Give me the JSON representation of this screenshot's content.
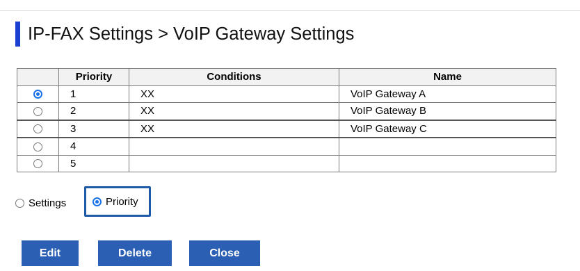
{
  "page": {
    "title": "IP-FAX Settings > VoIP Gateway Settings",
    "accent_color": "#1a3fd1"
  },
  "table": {
    "columns": [
      "",
      "Priority",
      "Conditions",
      "Name"
    ],
    "rows": [
      {
        "selected": true,
        "priority": "1",
        "conditions": "XX",
        "name": "VoIP Gateway A"
      },
      {
        "selected": false,
        "priority": "2",
        "conditions": "XX",
        "name": "VoIP Gateway B"
      },
      {
        "selected": false,
        "priority": "3",
        "conditions": "XX",
        "name": "VoIP Gateway C"
      },
      {
        "selected": false,
        "priority": "4",
        "conditions": "",
        "name": ""
      },
      {
        "selected": false,
        "priority": "5",
        "conditions": "",
        "name": ""
      }
    ]
  },
  "sort_options": {
    "settings_label": "Settings",
    "priority_label": "Priority",
    "selected": "Priority"
  },
  "buttons": {
    "edit": "Edit",
    "delete": "Delete",
    "close": "Close",
    "color": "#2b5fb3"
  }
}
